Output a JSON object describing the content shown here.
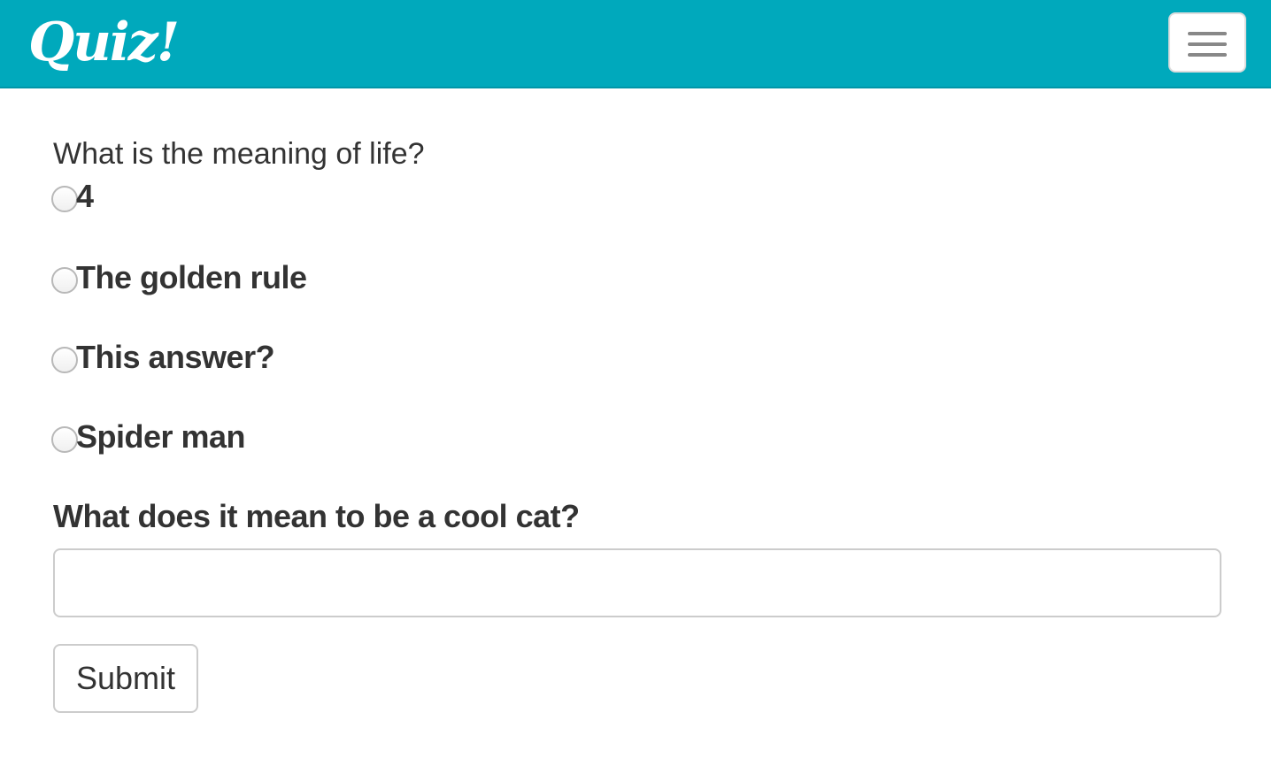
{
  "navbar": {
    "brand": "Quiz!",
    "toggle_icon": "hamburger-menu-icon"
  },
  "quiz": {
    "question1": {
      "label": "What is the meaning of life?",
      "options": [
        "4",
        "The golden rule",
        "This answer?",
        "Spider man"
      ]
    },
    "question2": {
      "label": "What does it mean to be a cool cat?",
      "value": "",
      "placeholder": ""
    },
    "submit_label": "Submit"
  },
  "colors": {
    "navbar_bg": "#00a9bc",
    "text": "#333333"
  }
}
